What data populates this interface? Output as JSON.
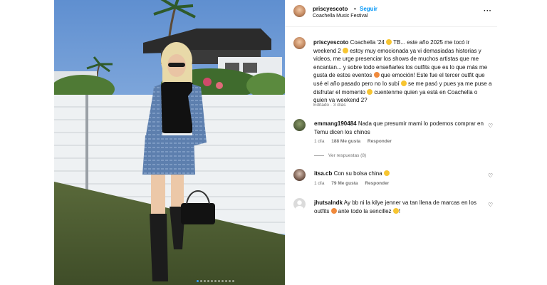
{
  "post": {
    "username": "priscyescoto",
    "separator": "•",
    "follow_label": "Seguir",
    "location": "Coachella Music Festival",
    "more_icon": "more-horizontal-icon",
    "carousel": {
      "current_slide": 1,
      "total_slides": 11,
      "next_icon": "chevron-right-icon"
    }
  },
  "caption": {
    "username": "priscyescoto",
    "text_1": "Coachella '24 ",
    "text_2": " TB... este año 2025 me tocó ir weekend 2 ",
    "text_3": " estoy muy emocionada ya vi demasiadas historias y videos, me urge presenciar los shows de muchos artistas que me encantan... y sobre todo enseñarles los outfits que es lo que más me gusta de estos eventos ",
    "text_4": " que emoción! Este fue el tercer outfit que usé el año pasado pero no lo subí ",
    "text_5": " se me pasó y pues ya me puse a disfrutar el momento ",
    "text_6": " cuentenme quien ya está en Coachella o quien va weekend 2?",
    "time": "Editado · 3 días"
  },
  "comments": [
    {
      "username": "emmang190484",
      "text": "Nada que presumir mami lo podemos comprar en Temu dicen los chinos",
      "time": "1 día",
      "likes": "188 Me gusta",
      "reply_label": "Responder",
      "view_replies": "Ver respuestas (8)"
    },
    {
      "username": "itsa.cb",
      "text": "Con su bolsa china ",
      "time": "1 día",
      "likes": "79 Me gusta",
      "reply_label": "Responder"
    },
    {
      "username": "jhutsalndk",
      "text_1": "Ay bb ni la kilye jenner va tan llena de marcas en los outfits ",
      "text_2": " ante todo la sencillez ",
      "text_3": "!"
    }
  ],
  "colors": {
    "link_blue": "#0095f6",
    "meta_gray": "#737373",
    "border": "#efefef"
  }
}
